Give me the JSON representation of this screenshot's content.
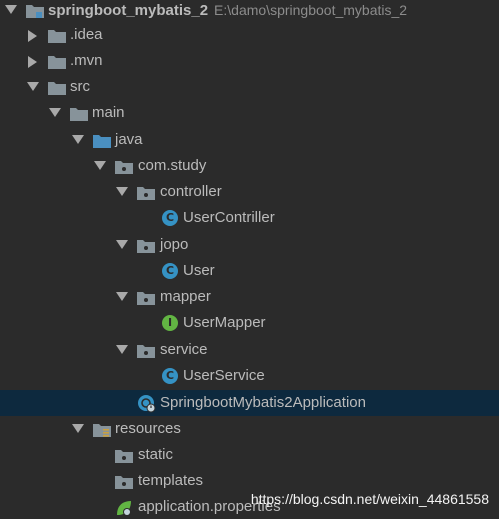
{
  "tree": {
    "project": {
      "name": "springboot_mybatis_2",
      "path": "E:\\damo\\springboot_mybatis_2"
    },
    "idea": ".idea",
    "mvn": ".mvn",
    "src": "src",
    "main": "main",
    "java": "java",
    "com_study": "com.study",
    "controller": "controller",
    "user_contriller": "UserContriller",
    "jopo": "jopo",
    "user": "User",
    "mapper": "mapper",
    "user_mapper": "UserMapper",
    "service": "service",
    "user_service": "UserService",
    "app_class": "SpringbootMybatis2Application",
    "resources": "resources",
    "static": "static",
    "templates": "templates",
    "app_properties": "application.properties"
  },
  "badges": {
    "class": "C",
    "interface": "I"
  },
  "watermark": "https://blog.csdn.net/weixin_44861558",
  "colors": {
    "background": "#2b2b2b",
    "selected_row": "#0d293e",
    "text": "#bbbbbb",
    "folder": "#87939a",
    "source_folder": "#4a8fc0",
    "class_badge": "#3592c4",
    "interface_badge": "#62b543"
  }
}
